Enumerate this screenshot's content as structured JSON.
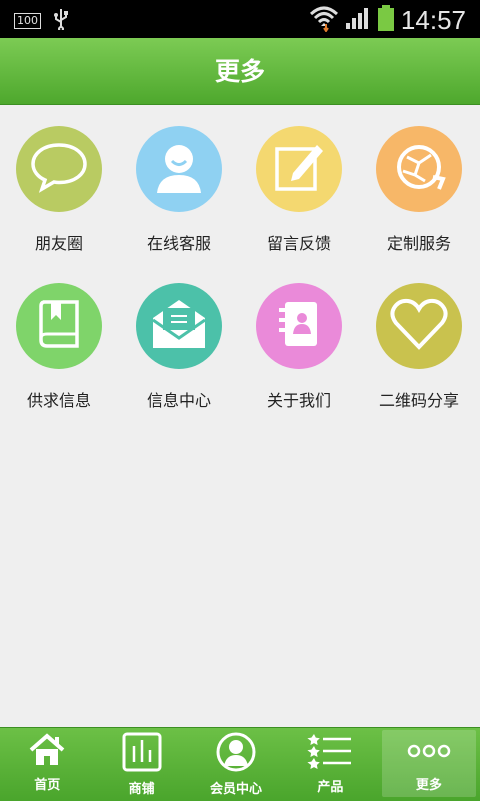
{
  "status_bar": {
    "battery_badge": "100",
    "time": "14:57"
  },
  "header": {
    "title": "更多"
  },
  "grid": [
    {
      "label": "朋友圈",
      "icon": "chat-bubble-icon",
      "color": "#b9cb62"
    },
    {
      "label": "在线客服",
      "icon": "user-avatar-icon",
      "color": "#8fd1f2"
    },
    {
      "label": "留言反馈",
      "icon": "edit-note-icon",
      "color": "#f4d870"
    },
    {
      "label": "定制服务",
      "icon": "globe-refresh-icon",
      "color": "#f7b768"
    },
    {
      "label": "供求信息",
      "icon": "bookmark-book-icon",
      "color": "#7fd46a"
    },
    {
      "label": "信息中心",
      "icon": "envelope-icon",
      "color": "#4cc1a9"
    },
    {
      "label": "关于我们",
      "icon": "contact-book-icon",
      "color": "#ea8ad9"
    },
    {
      "label": "二维码分享",
      "icon": "heart-icon",
      "color": "#c9c24e"
    }
  ],
  "tabs": [
    {
      "label": "首页",
      "icon": "home-icon"
    },
    {
      "label": "商铺",
      "icon": "store-bars-icon"
    },
    {
      "label": "会员中心",
      "icon": "member-avatar-icon"
    },
    {
      "label": "产品",
      "icon": "star-list-icon"
    },
    {
      "label": "更多",
      "icon": "more-dots-icon",
      "active": true
    }
  ]
}
